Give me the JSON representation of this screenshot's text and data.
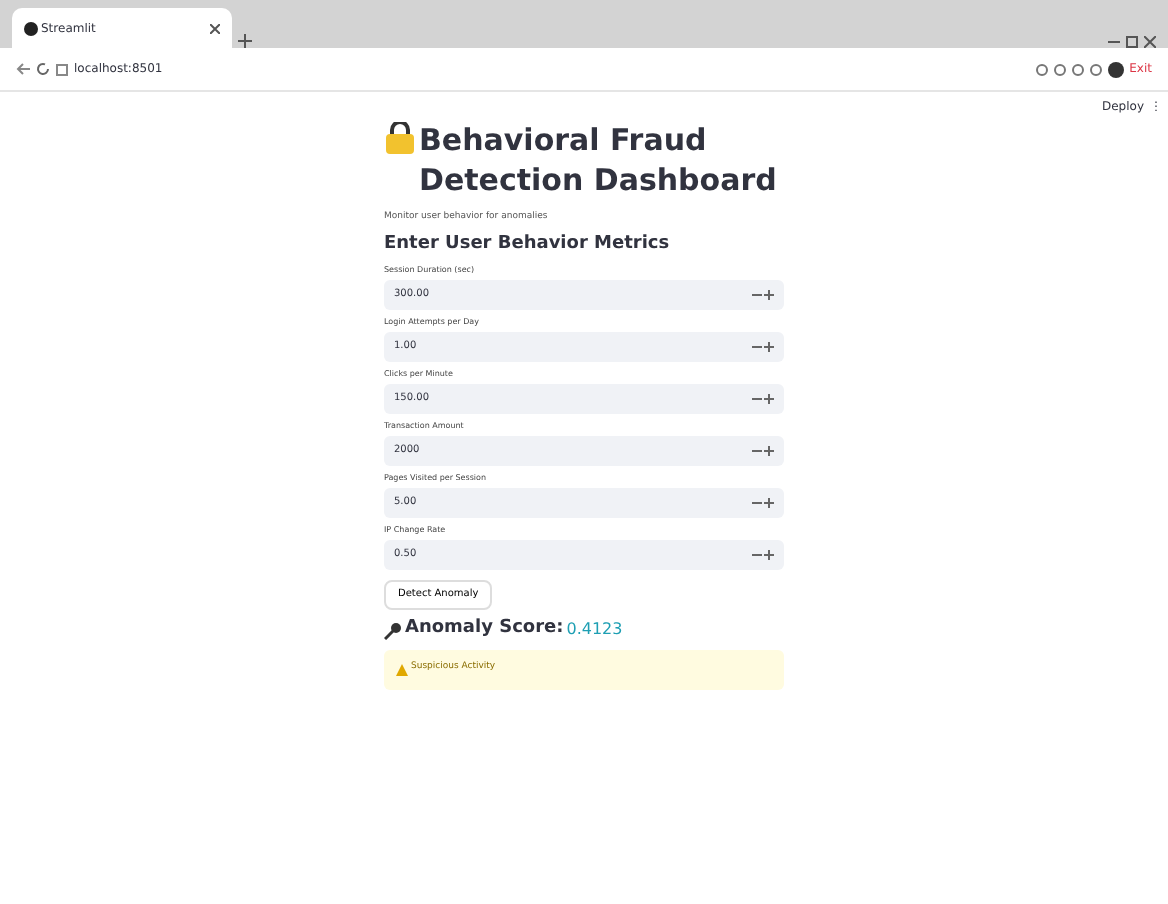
{
  "browser": {
    "tab_title": "Streamlit",
    "address": "localhost:8501",
    "profile_label": "Exit"
  },
  "app": {
    "deploy_label": "Deploy",
    "menu_glyph": "⋮",
    "title": "Behavioral Fraud Detection Dashboard",
    "subtitle": "Monitor user behavior for anomalies",
    "section_title": "Enter User Behavior Metrics",
    "fields": [
      {
        "label": "Session Duration (sec)",
        "value": "300.00"
      },
      {
        "label": "Login Attempts per Day",
        "value": "1.00"
      },
      {
        "label": "Clicks per Minute",
        "value": "150.00"
      },
      {
        "label": "Transaction Amount",
        "value": "2000"
      },
      {
        "label": "Pages Visited per Session",
        "value": "5.00"
      },
      {
        "label": "IP Change Rate",
        "value": "0.50"
      }
    ],
    "button": "Detect Anomaly",
    "score_label": "Anomaly Score:",
    "score_value": "0.4123",
    "alert": "Suspicious Activity"
  }
}
